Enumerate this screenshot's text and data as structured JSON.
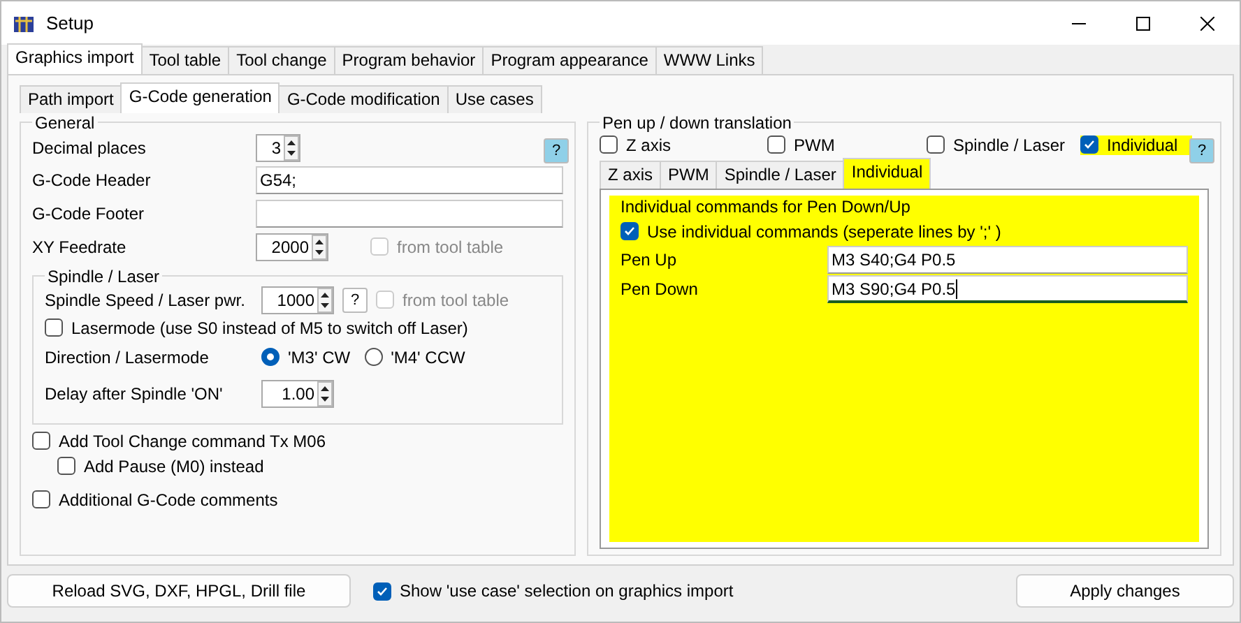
{
  "window": {
    "title": "Setup"
  },
  "main_tabs": [
    {
      "label": "Graphics import",
      "selected": true
    },
    {
      "label": "Tool table",
      "selected": false
    },
    {
      "label": "Tool change",
      "selected": false
    },
    {
      "label": "Program behavior",
      "selected": false
    },
    {
      "label": "Program appearance",
      "selected": false
    },
    {
      "label": "WWW Links",
      "selected": false
    }
  ],
  "sub_tabs": [
    {
      "label": "Path import",
      "selected": false
    },
    {
      "label": "G-Code generation",
      "selected": true
    },
    {
      "label": "G-Code modification",
      "selected": false
    },
    {
      "label": "Use cases",
      "selected": false
    }
  ],
  "general": {
    "legend": "General",
    "help": "?",
    "decimal_places": {
      "label": "Decimal places",
      "value": "3"
    },
    "header": {
      "label": "G-Code Header",
      "value": "G54;"
    },
    "footer": {
      "label": "G-Code Footer"
    },
    "xy_feedrate": {
      "label": "XY Feedrate",
      "value": "2000",
      "from_tool_table": {
        "label": "from tool table",
        "checked": false,
        "disabled": true
      }
    }
  },
  "spindle": {
    "legend": "Spindle / Laser",
    "speed": {
      "label": "Spindle Speed / Laser pwr.",
      "value": "1000",
      "help": "?",
      "from_tool_table": {
        "label": "from tool table",
        "checked": false,
        "disabled": true
      }
    },
    "lasermode": {
      "label": "Lasermode (use S0 instead of M5 to switch off Laser)",
      "checked": false
    },
    "direction": {
      "label": "Direction / Lasermode",
      "options": [
        {
          "label": "'M3' CW",
          "selected": true
        },
        {
          "label": "'M4' CCW",
          "selected": false
        }
      ]
    },
    "delay": {
      "label": "Delay after Spindle 'ON'",
      "value": "1.00"
    }
  },
  "options": [
    {
      "label": "Add Tool Change command Tx M06",
      "checked": false,
      "children": [
        {
          "label": "Add Pause (M0) instead",
          "checked": false
        }
      ]
    },
    {
      "label": "Additional G-Code comments",
      "checked": false
    }
  ],
  "pen": {
    "legend": "Pen up / down translation",
    "help": "?",
    "modes": [
      {
        "label": "Z axis",
        "checked": false,
        "highlighted": false
      },
      {
        "label": "PWM",
        "checked": false,
        "highlighted": false
      },
      {
        "label": "Spindle / Laser",
        "checked": false,
        "highlighted": false
      },
      {
        "label": "Individual",
        "checked": true,
        "highlighted": true
      }
    ],
    "tabs": [
      {
        "label": "Z axis",
        "selected": false
      },
      {
        "label": "PWM",
        "selected": false
      },
      {
        "label": "Spindle / Laser",
        "selected": false
      },
      {
        "label": "Individual",
        "selected": true
      }
    ],
    "individual": {
      "legend": "Individual commands for Pen Down/Up",
      "use": {
        "label": "Use individual commands (seperate lines by ';' )",
        "checked": true
      },
      "fields": [
        {
          "label": "Pen Up",
          "value": "M3 S40;G4 P0.5",
          "focused": false
        },
        {
          "label": "Pen Down",
          "value": "M3 S90;G4 P0.5",
          "focused": true
        }
      ]
    }
  },
  "bottom": {
    "reload": "Reload SVG, DXF, HPGL, Drill file",
    "show_use_case": {
      "label": "Show 'use case' selection on graphics import",
      "checked": true
    },
    "apply": "Apply changes"
  }
}
